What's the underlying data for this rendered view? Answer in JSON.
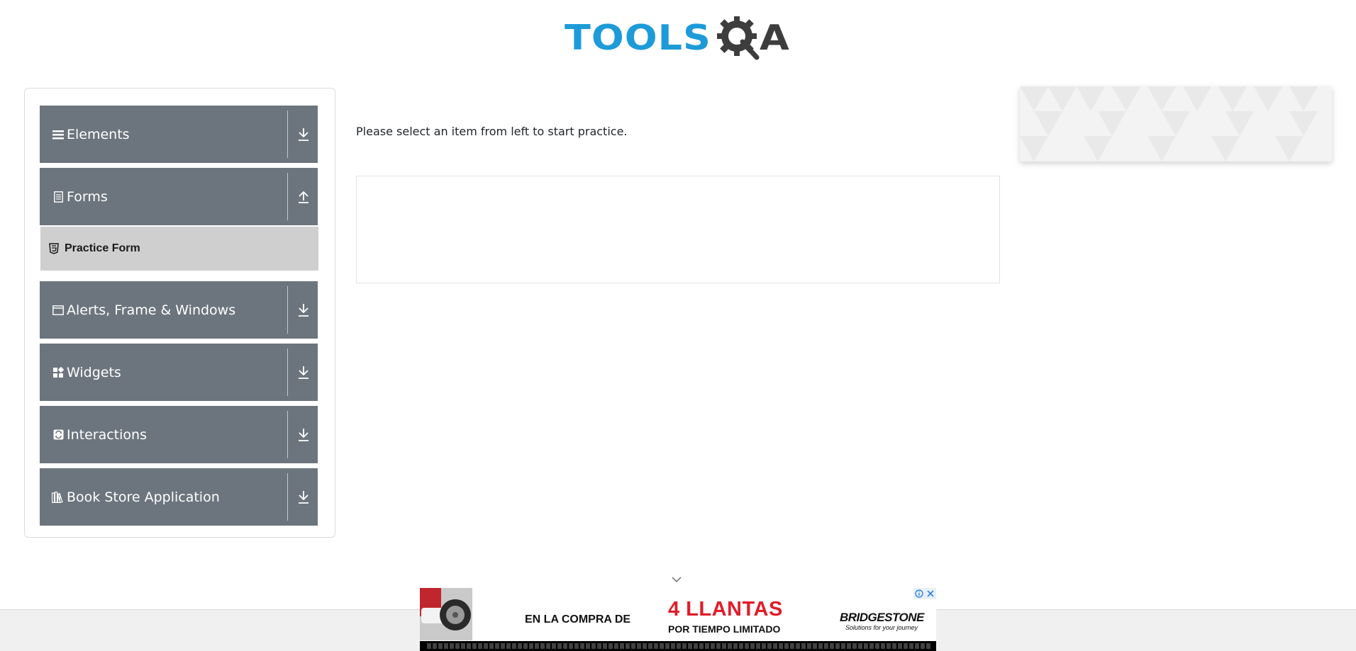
{
  "logo": {
    "part1": "TOOLS",
    "part2": "A",
    "gear": "gear-q-logo"
  },
  "sidebar": {
    "groups": [
      {
        "label": "Elements",
        "icon": "hamburger-icon",
        "arrow": "download-arrow-icon"
      },
      {
        "label": "Forms",
        "icon": "document-icon",
        "arrow": "upload-arrow-icon"
      },
      {
        "label": "Alerts, Frame & Windows",
        "icon": "window-icon",
        "arrow": "download-arrow-icon"
      },
      {
        "label": "Widgets",
        "icon": "widgets-icon",
        "arrow": "download-arrow-icon"
      },
      {
        "label": "Interactions",
        "icon": "interactions-icon",
        "arrow": "download-arrow-icon"
      },
      {
        "label": "Book Store Application",
        "icon": "books-icon",
        "arrow": "download-arrow-icon"
      }
    ],
    "forms_items": [
      {
        "label": "Practice Form",
        "icon": "html5-icon"
      }
    ]
  },
  "main": {
    "instruction": "Please select an item from left to start practice."
  },
  "ad": {
    "line1": "EN LA COMPRA DE",
    "line2": "4 LLANTAS",
    "line3": "POR TIEMPO LIMITADO",
    "brand": "BRIDGESTONE",
    "tagline": "Solutions for your journey"
  },
  "colors": {
    "logo_blue": "#1d9bd8",
    "logo_dark": "#3d3d3d",
    "group_bg": "#6c757d",
    "active_item_bg": "#cfcfcf",
    "ad_red": "#e11d2a"
  }
}
